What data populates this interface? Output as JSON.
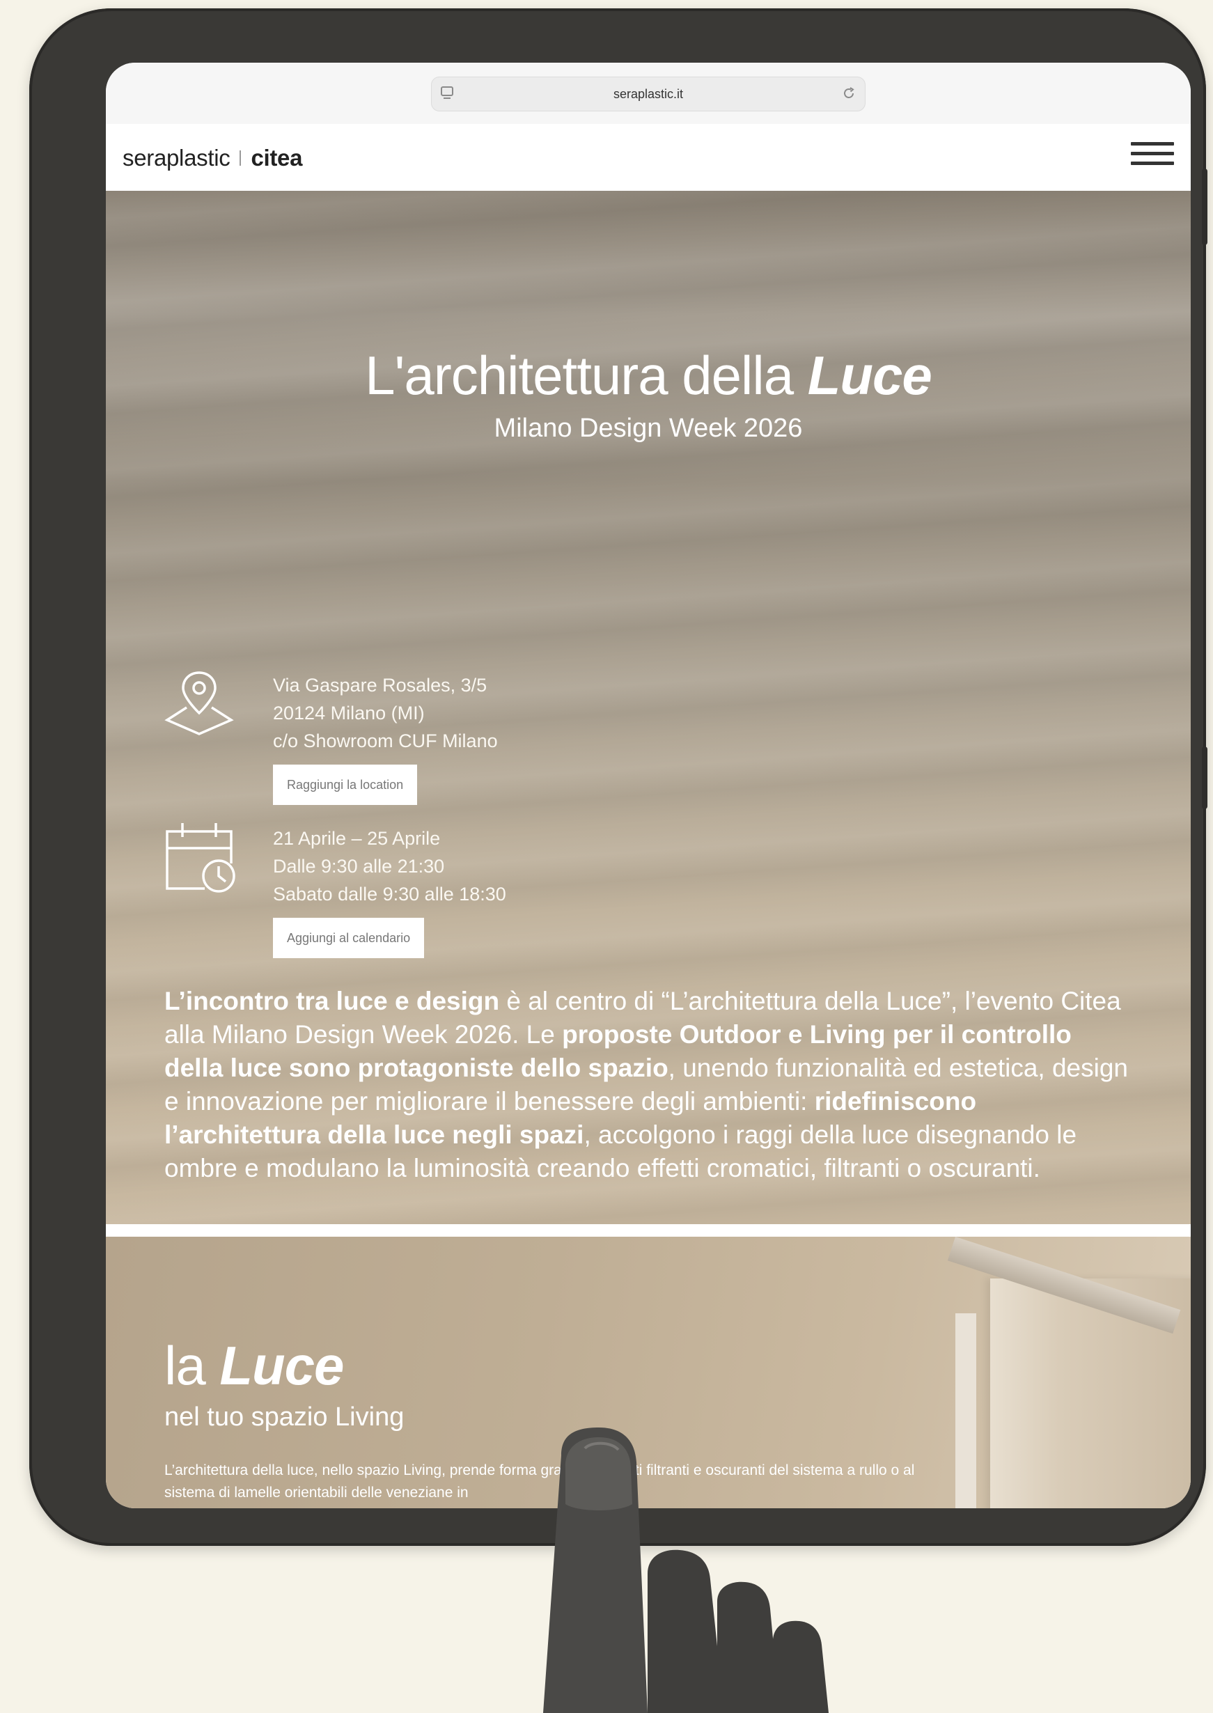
{
  "browser": {
    "url": "seraplastic.it"
  },
  "header": {
    "logo_left": "seraplastic",
    "logo_right": "citea"
  },
  "hero": {
    "title_prefix": "L'architettura della ",
    "title_emphasis": "Luce",
    "subtitle": "Milano Design Week 2026",
    "location": {
      "line1": "Via Gaspare Rosales, 3/5",
      "line2": "20124 Milano (MI)",
      "line3": "c/o Showroom CUF Milano",
      "button": "Raggiungi la location"
    },
    "dates": {
      "line1": "21 Aprile – 25 Aprile",
      "line2": "Dalle 9:30 alle 21:30",
      "line3": "Sabato dalle 9:30 alle 18:30",
      "button": "Aggiungi al calendario"
    },
    "paragraph": {
      "b1": "L’incontro tra luce e design",
      "t1": " è al centro di “L’architettura della Luce”, l’evento Citea alla Milano Design Week 2026. Le ",
      "b2": "proposte Outdoor e Living per il controllo della luce sono protagoniste dello spazio",
      "t2": ", unendo funzionalità ed estetica, design e innovazione per migliorare il benessere degli ambienti: ",
      "b3": "ridefiniscono l’architettura della luce negli spazi",
      "t3": ", accolgono i raggi della luce disegnando le ombre e modulano la luminosità creando effetti cromatici, filtranti o oscuranti."
    }
  },
  "section_living": {
    "title_prefix": "la ",
    "title_emphasis": "Luce",
    "subtitle": "nel tuo spazio Living",
    "text": "L’architettura della luce, nello spazio Living, prende forma grazie ai tessuti filtranti e oscuranti del sistema a rullo o al sistema di lamelle orientabili delle veneziane in"
  },
  "icons": {
    "location": "location-pin-icon",
    "calendar": "calendar-clock-icon",
    "menu": "hamburger-menu-icon",
    "reload": "reload-icon",
    "page": "page-icon"
  },
  "colors": {
    "page_background": "#f6f3e8",
    "tablet_frame": "#3a3936",
    "hero_top": "#8c8376",
    "hero_bottom": "#c8b8a0",
    "text_light": "#ffffff"
  }
}
